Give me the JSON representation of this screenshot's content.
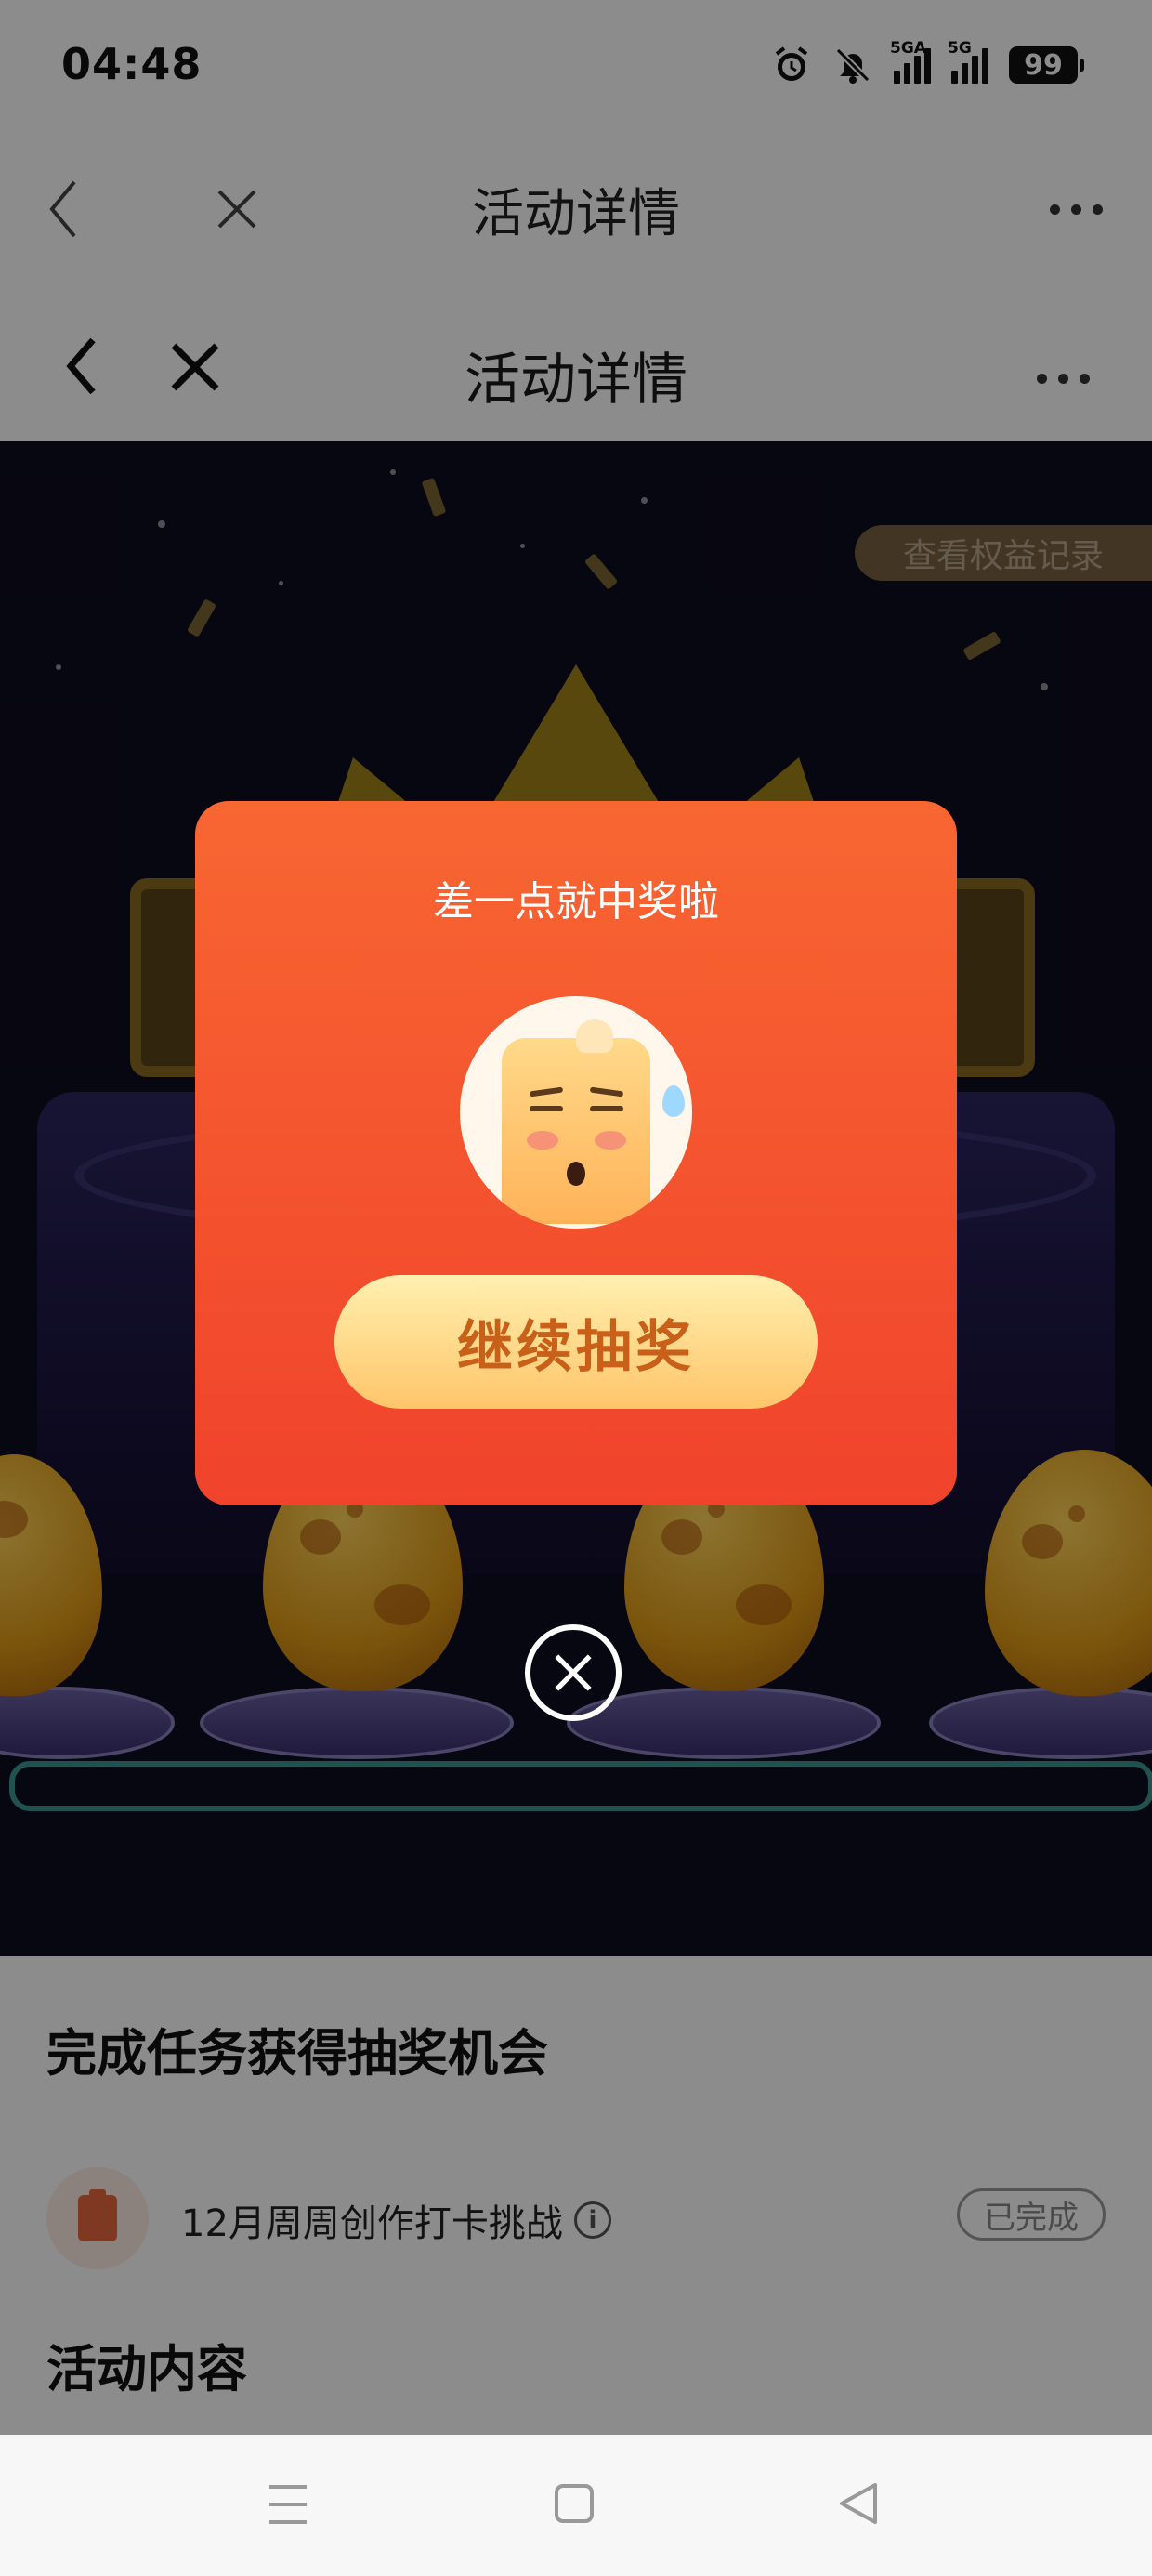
{
  "status_bar": {
    "time": "04:48",
    "signal1_label": "5GA",
    "signal2_label": "5G",
    "battery": "99",
    "icons": [
      "alarm-icon",
      "mute-icon",
      "signal-5ga-icon",
      "signal-5g-icon",
      "battery-icon"
    ]
  },
  "nav_outer": {
    "title": "活动详情",
    "icons": [
      "back-icon",
      "close-icon",
      "more-icon"
    ]
  },
  "nav_inner": {
    "title": "活动详情",
    "icons": [
      "back-icon",
      "close-icon",
      "more-icon"
    ]
  },
  "game": {
    "records_button": "查看权益记录"
  },
  "popup": {
    "title": "差一点就中奖啦",
    "continue_button": "继续抽奖",
    "close_icon": "close-circle-icon"
  },
  "tasks_section": {
    "title": "完成任务获得抽奖机会",
    "items": [
      {
        "label": "12月周周创作打卡挑战",
        "info_icon": "info-icon",
        "status": "已完成"
      }
    ]
  },
  "content_section": {
    "title": "活动内容"
  },
  "system_nav": {
    "icons": [
      "menu-icon",
      "home-square-icon",
      "back-triangle-icon"
    ]
  },
  "colors": {
    "popup_top": "#f86632",
    "popup_bottom": "#f0432c",
    "button_gradient": [
      "#fff0b0",
      "#ffc56a"
    ],
    "button_text": "#c8601a",
    "game_background": "#0e0d1f"
  }
}
